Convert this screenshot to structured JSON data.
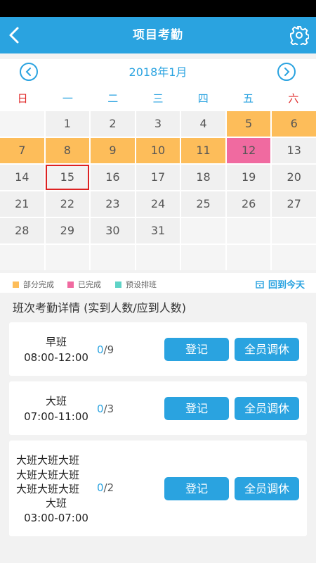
{
  "header": {
    "title": "项目考勤",
    "back_icon": "back-arrow-icon",
    "settings_icon": "gear-icon"
  },
  "calendar": {
    "month_label": "2018年1月",
    "weekdays": [
      "日",
      "一",
      "二",
      "三",
      "四",
      "五",
      "六"
    ],
    "rows": [
      [
        {
          "d": "",
          "s": "white"
        },
        {
          "d": "1",
          "s": "none"
        },
        {
          "d": "2",
          "s": "none"
        },
        {
          "d": "3",
          "s": "none"
        },
        {
          "d": "4",
          "s": "none"
        },
        {
          "d": "5",
          "s": "partial"
        },
        {
          "d": "6",
          "s": "partial"
        }
      ],
      [
        {
          "d": "7",
          "s": "partial"
        },
        {
          "d": "8",
          "s": "partial"
        },
        {
          "d": "9",
          "s": "partial"
        },
        {
          "d": "10",
          "s": "partial"
        },
        {
          "d": "11",
          "s": "partial"
        },
        {
          "d": "12",
          "s": "done"
        },
        {
          "d": "13",
          "s": "none"
        }
      ],
      [
        {
          "d": "14",
          "s": "none"
        },
        {
          "d": "15",
          "s": "today"
        },
        {
          "d": "16",
          "s": "none"
        },
        {
          "d": "17",
          "s": "none"
        },
        {
          "d": "18",
          "s": "none"
        },
        {
          "d": "19",
          "s": "none"
        },
        {
          "d": "20",
          "s": "none"
        }
      ],
      [
        {
          "d": "21",
          "s": "none"
        },
        {
          "d": "22",
          "s": "none"
        },
        {
          "d": "23",
          "s": "none"
        },
        {
          "d": "24",
          "s": "none"
        },
        {
          "d": "25",
          "s": "none"
        },
        {
          "d": "26",
          "s": "none"
        },
        {
          "d": "27",
          "s": "none"
        }
      ],
      [
        {
          "d": "28",
          "s": "none"
        },
        {
          "d": "29",
          "s": "none"
        },
        {
          "d": "30",
          "s": "none"
        },
        {
          "d": "31",
          "s": "none"
        },
        {
          "d": "",
          "s": "white"
        },
        {
          "d": "",
          "s": "white"
        },
        {
          "d": "",
          "s": "white"
        }
      ],
      [
        {
          "d": "",
          "s": "white"
        },
        {
          "d": "",
          "s": "white"
        },
        {
          "d": "",
          "s": "white"
        },
        {
          "d": "",
          "s": "white"
        },
        {
          "d": "",
          "s": "white"
        },
        {
          "d": "",
          "s": "white"
        },
        {
          "d": "",
          "s": "white"
        }
      ]
    ]
  },
  "legend": {
    "partial": "部分完成",
    "done": "已完成",
    "preset": "预设排班",
    "today_link": "回到今天",
    "colors": {
      "partial": "#fdbd5a",
      "done": "#f06aa0",
      "preset": "#5fd3c7"
    }
  },
  "section_title": "班次考勤详情 (实到人数/应到人数)",
  "shifts": [
    {
      "name": "早班",
      "time": "08:00-12:00",
      "actual": "0",
      "expected": "/9"
    },
    {
      "name": "大班",
      "time": "07:00-11:00",
      "actual": "0",
      "expected": "/3"
    },
    {
      "name_lines": [
        "大班大班大班",
        "大班大班大班",
        "大班大班大班",
        "大班"
      ],
      "time": "03:00-07:00",
      "actual": "0",
      "expected": "/2"
    }
  ],
  "buttons": {
    "register": "登记",
    "all_rest": "全员调休"
  },
  "colors": {
    "accent": "#2aa3e0",
    "today_border": "#dd2222",
    "weekend": "#e02a2a"
  }
}
